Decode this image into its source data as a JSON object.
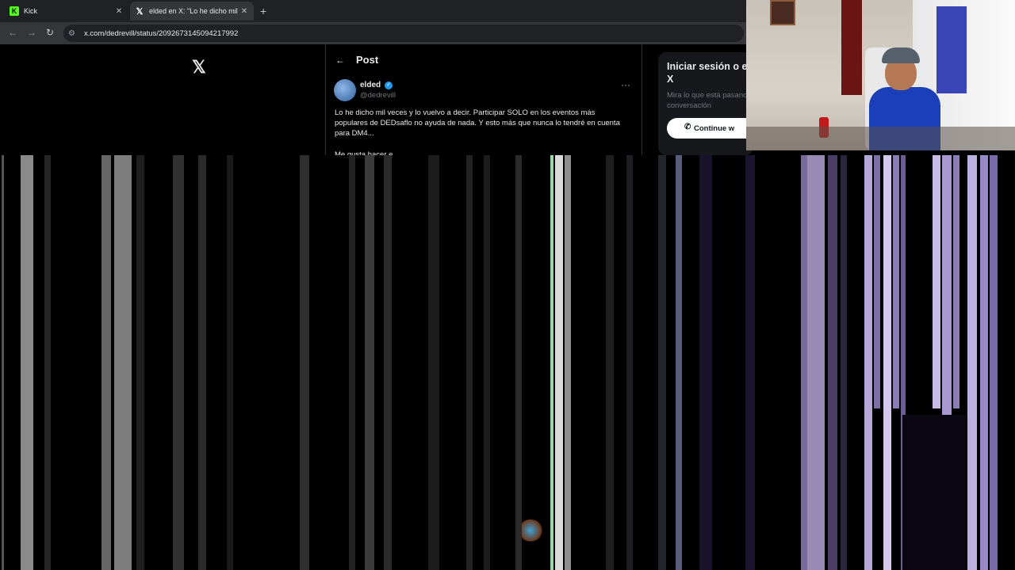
{
  "browser": {
    "tabs": [
      {
        "label": "Kick",
        "favicon": "kick-icon",
        "active": false
      },
      {
        "label": "elded en X: \"Lo he dicho mil veces",
        "favicon": "x-logo-icon",
        "active": true
      }
    ],
    "url": "x.com/dedrevill/status/2092673145094217992",
    "close_glyph": "✕",
    "new_tab_glyph": "+"
  },
  "x": {
    "logo": "𝕏",
    "post_header": {
      "back_glyph": "←",
      "title": "Post"
    },
    "author": {
      "name": "elded",
      "handle": "@dedrevill",
      "verified": true
    },
    "more_glyph": "···",
    "post_text": "Lo he dicho mil veces y lo vuelvo a decir. Participar SOLO en los eventos más populares de DEDsaflo no ayuda de nada. Y esto más que nunca lo tendré en cuenta para DM4...",
    "post_text_2": "Me gusta hacer e",
    "login": {
      "title": "Iniciar sesión o en X",
      "subtitle": "Mira lo que está pasando conversación",
      "continue_label": "Continue w"
    }
  },
  "colors": {
    "background": "#000000",
    "chrome_dark": "#202124",
    "chrome_toolbar": "#35363a",
    "verified_blue": "#1d9bf0",
    "kick_green": "#53fc18"
  }
}
